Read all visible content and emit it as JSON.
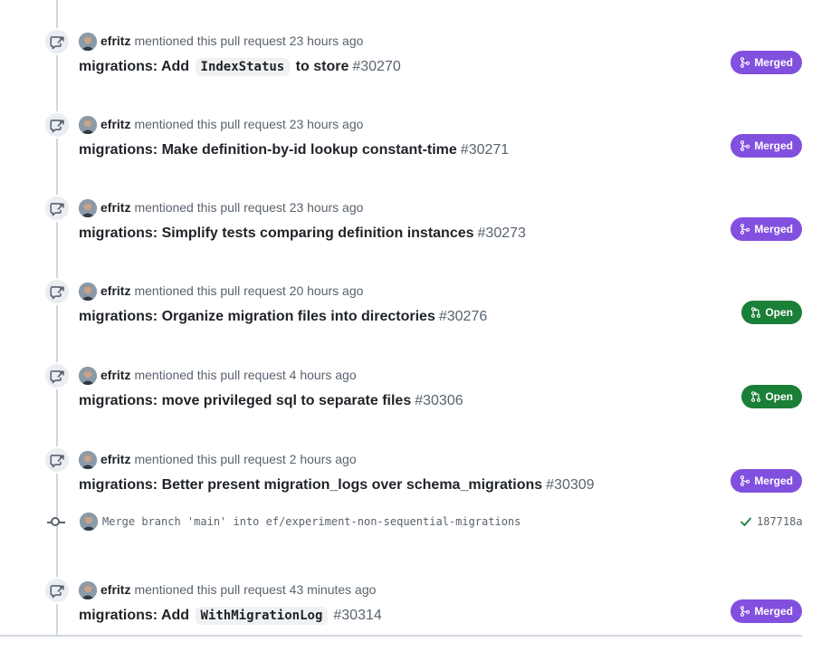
{
  "colors": {
    "merged": "#8250df",
    "open": "#1a7f37",
    "check": "#1a7f37",
    "muted": "#59636e",
    "timeline": "#d0d7de"
  },
  "events": [
    {
      "author": "efritz",
      "action": "mentioned this pull request",
      "time": "23 hours ago",
      "title_parts": [
        {
          "t": "text",
          "v": "migrations: Add "
        },
        {
          "t": "code",
          "v": "IndexStatus"
        },
        {
          "t": "text",
          "v": " to store"
        }
      ],
      "number": "#30270",
      "state": "Merged",
      "state_kind": "merged",
      "icon": "cross-reference-icon"
    },
    {
      "author": "efritz",
      "action": "mentioned this pull request",
      "time": "23 hours ago",
      "title_parts": [
        {
          "t": "text",
          "v": "migrations: Make definition-by-id lookup constant-time"
        }
      ],
      "number": "#30271",
      "state": "Merged",
      "state_kind": "merged",
      "icon": "cross-reference-icon"
    },
    {
      "author": "efritz",
      "action": "mentioned this pull request",
      "time": "23 hours ago",
      "title_parts": [
        {
          "t": "text",
          "v": "migrations: Simplify tests comparing definition instances"
        }
      ],
      "number": "#30273",
      "state": "Merged",
      "state_kind": "merged",
      "icon": "cross-reference-icon"
    },
    {
      "author": "efritz",
      "action": "mentioned this pull request",
      "time": "20 hours ago",
      "title_parts": [
        {
          "t": "text",
          "v": "migrations: Organize migration files into directories"
        }
      ],
      "number": "#30276",
      "state": "Open",
      "state_kind": "open",
      "icon": "cross-reference-icon"
    },
    {
      "author": "efritz",
      "action": "mentioned this pull request",
      "time": "4 hours ago",
      "title_parts": [
        {
          "t": "text",
          "v": "migrations: move privileged sql to separate files"
        }
      ],
      "number": "#30306",
      "state": "Open",
      "state_kind": "open",
      "icon": "cross-reference-icon"
    },
    {
      "author": "efritz",
      "action": "mentioned this pull request",
      "time": "2 hours ago",
      "title_parts": [
        {
          "t": "text",
          "v": "migrations: Better present migration_logs over schema_migrations"
        }
      ],
      "number": "#30309",
      "state": "Merged",
      "state_kind": "merged",
      "icon": "cross-reference-icon"
    },
    {
      "author": "efritz",
      "action": "mentioned this pull request",
      "time": "43 minutes ago",
      "title_parts": [
        {
          "t": "text",
          "v": "migrations: Add "
        },
        {
          "t": "code",
          "v": "WithMigrationLog"
        }
      ],
      "number": "#30314",
      "state": "Merged",
      "state_kind": "merged",
      "icon": "cross-reference-icon"
    }
  ],
  "commit": {
    "message": "Merge branch 'main' into ef/experiment-non-sequential-migrations",
    "status": "check-icon",
    "sha": "187718a"
  }
}
